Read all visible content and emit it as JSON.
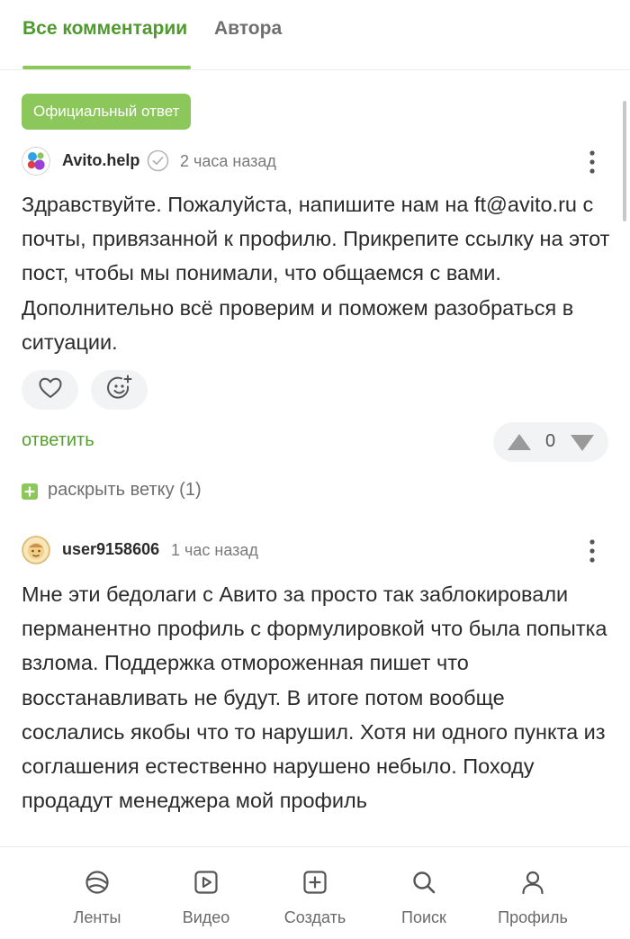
{
  "tabs": {
    "all_comments": "Все комментарии",
    "author": "Автора"
  },
  "colors": {
    "accent_green": "#8bc75b",
    "tab_active_text": "#4e9a2e",
    "link_green": "#55a030"
  },
  "comments": [
    {
      "badge": "Официальный ответ",
      "author": "Avito.help",
      "verified": true,
      "time": "2 часа назад",
      "text": "Здравствуйте. Пожалуйста, напишите нам на ft@avito.ru с почты, привязанной к профилю. Прикрепите ссылку на этот пост, чтобы мы понимали, что общаемся с вами. Дополнительно всё проверим и поможем разобраться в ситуации.",
      "reply_label": "ответить",
      "score": "0",
      "expand_label": "раскрыть ветку (1)"
    },
    {
      "author": "user9158606",
      "time": "1 час назад",
      "text": "Мне эти бедолаги с Авито за просто так заблокировали перманентно профиль с формулировкой что была попытка взлома. Поддержка отмороженная пишет что восстанавливать не будут. В итоге потом вообще сослались якобы что то нарушил. Хотя ни одного пункта из соглашения естественно нарушено небыло. Походу продадут менеджера мой профиль"
    }
  ],
  "icons": {
    "like": "heart-icon",
    "reaction": "add-emoji-icon",
    "upvote": "arrow-up-icon",
    "downvote": "arrow-down-icon",
    "more": "more-vertical-icon"
  },
  "bottom_nav": [
    {
      "label": "Ленты",
      "icon": "feed-icon"
    },
    {
      "label": "Видео",
      "icon": "video-icon"
    },
    {
      "label": "Создать",
      "icon": "create-icon"
    },
    {
      "label": "Поиск",
      "icon": "search-icon"
    },
    {
      "label": "Профиль",
      "icon": "profile-icon"
    }
  ]
}
